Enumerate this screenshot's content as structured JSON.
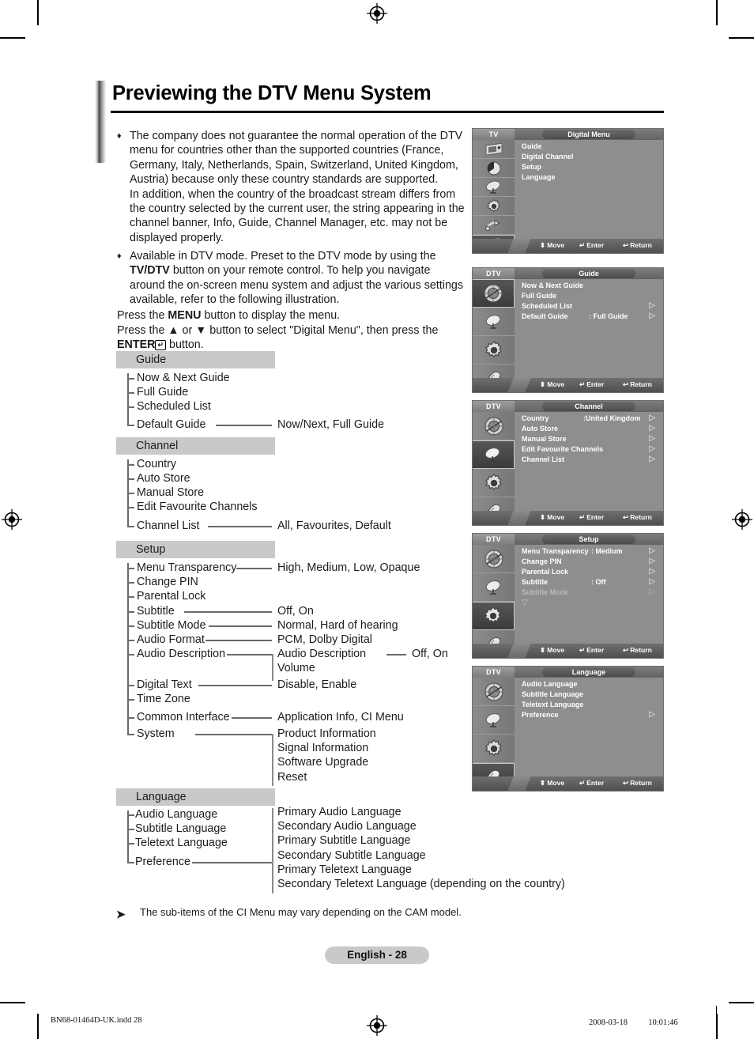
{
  "page": {
    "title": "Previewing the DTV Menu System",
    "badge": "English - 28",
    "note_arrow": "➤",
    "note": "The sub-items of the CI Menu may vary depending on the CAM model."
  },
  "intro": {
    "bullet_glyph": "♦",
    "bullet1": "The company does not guarantee the normal operation of the DTV menu for countries other than the supported countries (France, Germany, Italy, Netherlands, Spain, Switzerland, United Kingdom, Austria) because only these country standards are supported.",
    "bullet1_b": "In addition, when the country of the broadcast stream differs from the country selected by the current user, the string appearing in the channel banner, Info, Guide, Channel Manager, etc. may not be displayed properly.",
    "bullet2_pre": "Available in DTV mode. Preset to the DTV mode by using the ",
    "bullet2_bold": "TV/DTV",
    "bullet2_post": " button on your remote control. To help you navigate around the on-screen menu system and adjust the various settings available, refer to the following illustration.",
    "press1_pre": "Press the ",
    "press1_bold": "MENU",
    "press1_post": " button to display the menu.",
    "press2_pre": "Press the ▲ or ▼ button to select \"Digital Menu\", then press the ",
    "press2_bold": "ENTER",
    "press2_glyph": "↵",
    "press2_post": " button."
  },
  "tree": {
    "sections": [
      {
        "name": "Guide",
        "items": [
          "Now & Next Guide",
          "Full Guide",
          "Scheduled List",
          "Default Guide"
        ],
        "values": [
          "Now/Next, Full Guide"
        ]
      },
      {
        "name": "Channel",
        "items": [
          "Country",
          "Auto Store",
          "Manual Store",
          "Edit Favourite Channels",
          "Channel List"
        ],
        "values": [
          "All, Favourites, Default"
        ]
      },
      {
        "name": "Setup",
        "items": [
          "Menu Transparency",
          "Change PIN",
          "Parental Lock",
          "Subtitle",
          "Subtitle Mode",
          "Audio Format",
          "Audio Description",
          "Digital Text",
          "Time Zone",
          "Common Interface",
          "System"
        ],
        "values": [
          "High, Medium, Low, Opaque",
          "Off, On",
          "Normal, Hard of hearing",
          "PCM, Dolby Digital",
          "Audio Description",
          "Off, On",
          "Volume",
          "Disable, Enable",
          "Application Info, CI Menu",
          "Product Information",
          "Signal Information",
          "Software Upgrade",
          "Reset"
        ]
      },
      {
        "name": "Language",
        "items": [
          "Audio Language",
          "Subtitle Language",
          "Teletext Language",
          "Preference"
        ],
        "values": [
          "Primary Audio Language",
          "Secondary Audio Language",
          "Primary Subtitle Language",
          "Secondary Subtitle Language",
          "Primary Teletext Language",
          "Secondary Teletext Language (depending on the country)"
        ]
      }
    ]
  },
  "tv_screens": [
    {
      "mode": "TV",
      "title": "Digital Menu",
      "selected_icon_index": 5,
      "icon_count": 6,
      "icons": [
        "picture-icon",
        "sound-icon",
        "channel-icon",
        "setup-icon",
        "input-icon",
        "digital-menu-icon"
      ],
      "rows": [
        {
          "label": "Guide",
          "value": "",
          "arrow": false,
          "dim": false
        },
        {
          "label": "Digital Channel",
          "value": "",
          "arrow": false,
          "dim": false
        },
        {
          "label": "Setup",
          "value": "",
          "arrow": false,
          "dim": false
        },
        {
          "label": "Language",
          "value": "",
          "arrow": false,
          "dim": false
        }
      ],
      "footer": {
        "move": "Move",
        "enter": "Enter",
        "return": "Return"
      }
    },
    {
      "mode": "DTV",
      "title": "Guide",
      "selected_icon_index": 0,
      "icon_count": 4,
      "icons": [
        "guide-icon",
        "channel-icon",
        "setup-icon",
        "language-icon"
      ],
      "rows": [
        {
          "label": "Now & Next Guide",
          "value": "",
          "arrow": false,
          "dim": false
        },
        {
          "label": "Full Guide",
          "value": "",
          "arrow": false,
          "dim": false
        },
        {
          "label": "Scheduled List",
          "value": "",
          "arrow": true,
          "dim": false
        },
        {
          "label": "Default Guide",
          "value": ": Full Guide",
          "arrow": true,
          "dim": false
        }
      ],
      "footer": {
        "move": "Move",
        "enter": "Enter",
        "return": "Return"
      }
    },
    {
      "mode": "DTV",
      "title": "Channel",
      "selected_icon_index": 1,
      "icon_count": 4,
      "icons": [
        "guide-icon",
        "channel-icon",
        "setup-icon",
        "language-icon"
      ],
      "rows": [
        {
          "label": "Country",
          "value": ":United Kingdom",
          "arrow": true,
          "dim": false
        },
        {
          "label": "Auto Store",
          "value": "",
          "arrow": true,
          "dim": false
        },
        {
          "label": "Manual Store",
          "value": "",
          "arrow": true,
          "dim": false
        },
        {
          "label": "Edit Favourite Channels",
          "value": "",
          "arrow": true,
          "dim": false
        },
        {
          "label": "Channel List",
          "value": "",
          "arrow": true,
          "dim": false
        }
      ],
      "footer": {
        "move": "Move",
        "enter": "Enter",
        "return": "Return"
      }
    },
    {
      "mode": "DTV",
      "title": "Setup",
      "selected_icon_index": 2,
      "icon_count": 4,
      "icons": [
        "guide-icon",
        "channel-icon",
        "setup-icon",
        "language-icon"
      ],
      "rows": [
        {
          "label": "Menu Transparency",
          "value": ": Medium",
          "arrow": true,
          "dim": false
        },
        {
          "label": "Change PIN",
          "value": "",
          "arrow": true,
          "dim": false
        },
        {
          "label": "Parental Lock",
          "value": "",
          "arrow": true,
          "dim": false
        },
        {
          "label": "Subtitle",
          "value": ": Off",
          "arrow": true,
          "dim": false
        },
        {
          "label": "Subtitle  Mode",
          "value": "",
          "arrow": true,
          "dim": true
        }
      ],
      "more_glyph": "▽",
      "footer": {
        "move": "Move",
        "enter": "Enter",
        "return": "Return"
      }
    },
    {
      "mode": "DTV",
      "title": "Language",
      "selected_icon_index": 3,
      "icon_count": 4,
      "icons": [
        "guide-icon",
        "channel-icon",
        "setup-icon",
        "language-icon"
      ],
      "rows": [
        {
          "label": "Audio Language",
          "value": "",
          "arrow": false,
          "dim": false
        },
        {
          "label": "Subtitle Language",
          "value": "",
          "arrow": false,
          "dim": false
        },
        {
          "label": "Teletext Language",
          "value": "",
          "arrow": false,
          "dim": false
        },
        {
          "label": "Preference",
          "value": "",
          "arrow": true,
          "dim": false
        }
      ],
      "footer": {
        "move": "Move",
        "enter": "Enter",
        "return": "Return"
      }
    }
  ],
  "footer": {
    "left": "BN68-01464D-UK.indd   28",
    "right": "2008-03-18   　　 10:01:46"
  }
}
